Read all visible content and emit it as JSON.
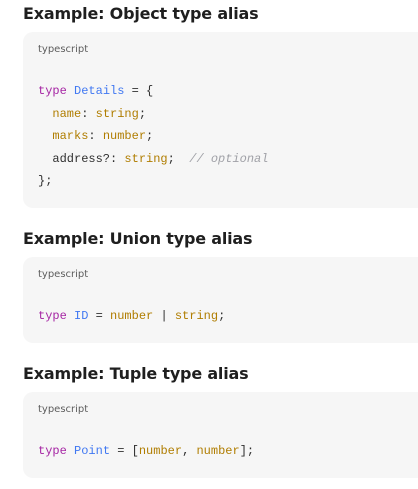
{
  "sections": [
    {
      "title": "Example: Object type alias",
      "language": "typescript",
      "lines": [
        [
          {
            "text": "type",
            "kind": "keyword"
          },
          {
            "text": " ",
            "kind": "punct"
          },
          {
            "text": "Details",
            "kind": "type-name"
          },
          {
            "text": " = {",
            "kind": "punct"
          }
        ],
        [
          {
            "text": "  ",
            "kind": "punct"
          },
          {
            "text": "name",
            "kind": "prop"
          },
          {
            "text": ": ",
            "kind": "punct"
          },
          {
            "text": "string",
            "kind": "type"
          },
          {
            "text": ";",
            "kind": "punct"
          }
        ],
        [
          {
            "text": "  ",
            "kind": "punct"
          },
          {
            "text": "marks",
            "kind": "prop"
          },
          {
            "text": ": ",
            "kind": "punct"
          },
          {
            "text": "number",
            "kind": "type"
          },
          {
            "text": ";",
            "kind": "punct"
          }
        ],
        [
          {
            "text": "  address?: ",
            "kind": "punct"
          },
          {
            "text": "string",
            "kind": "type"
          },
          {
            "text": ";  ",
            "kind": "punct"
          },
          {
            "text": "// optional",
            "kind": "comment"
          }
        ],
        [
          {
            "text": "};",
            "kind": "punct"
          }
        ]
      ]
    },
    {
      "title": "Example: Union type alias",
      "language": "typescript",
      "lines": [
        [
          {
            "text": "type",
            "kind": "keyword"
          },
          {
            "text": " ",
            "kind": "punct"
          },
          {
            "text": "ID",
            "kind": "type-name"
          },
          {
            "text": " = ",
            "kind": "punct"
          },
          {
            "text": "number",
            "kind": "type"
          },
          {
            "text": " | ",
            "kind": "punct"
          },
          {
            "text": "string",
            "kind": "type"
          },
          {
            "text": ";",
            "kind": "punct"
          }
        ]
      ]
    },
    {
      "title": "Example: Tuple type alias",
      "language": "typescript",
      "lines": [
        [
          {
            "text": "type",
            "kind": "keyword"
          },
          {
            "text": " ",
            "kind": "punct"
          },
          {
            "text": "Point",
            "kind": "type-name"
          },
          {
            "text": " = [",
            "kind": "punct"
          },
          {
            "text": "number",
            "kind": "type"
          },
          {
            "text": ", ",
            "kind": "punct"
          },
          {
            "text": "number",
            "kind": "type"
          },
          {
            "text": "];",
            "kind": "punct"
          }
        ]
      ]
    }
  ]
}
